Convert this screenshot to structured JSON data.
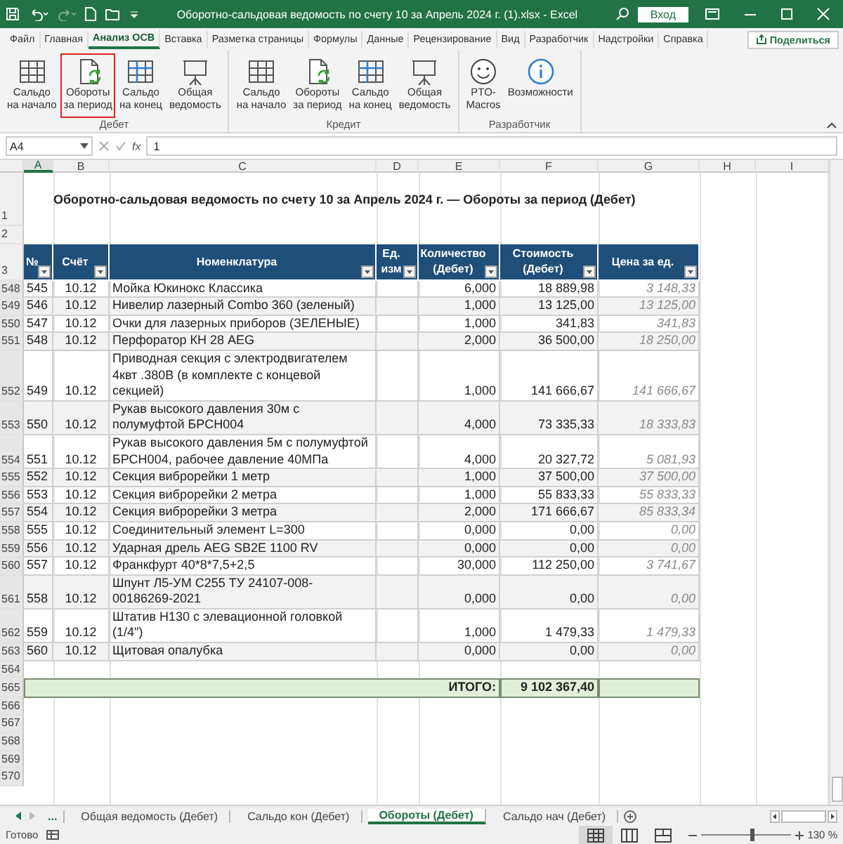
{
  "window": {
    "title": "Оборотно-сальдовая ведомость по счету 10 за Апрель 2024 г. (1).xlsx  -  Excel",
    "sign_in": "Вход",
    "redo_disabled": true
  },
  "ribbon_tabs": [
    {
      "label": "Файл",
      "selected": false
    },
    {
      "label": "Главная",
      "selected": false
    },
    {
      "label": "Анализ ОСВ",
      "selected": true
    },
    {
      "label": "Вставка",
      "selected": false
    },
    {
      "label": "Разметка страницы",
      "selected": false
    },
    {
      "label": "Формулы",
      "selected": false
    },
    {
      "label": "Данные",
      "selected": false
    },
    {
      "label": "Рецензирование",
      "selected": false
    },
    {
      "label": "Вид",
      "selected": false
    },
    {
      "label": "Разработчик",
      "selected": false
    },
    {
      "label": "Надстройки",
      "selected": false
    },
    {
      "label": "Справка",
      "selected": false
    }
  ],
  "share_button": "Поделиться",
  "ribbon_groups": [
    {
      "label": "Дебет",
      "buttons": [
        {
          "label": "Сальдо\nна начало",
          "highlighted": false
        },
        {
          "label": "Обороты\nза период",
          "highlighted": true
        },
        {
          "label": "Сальдо\nна конец",
          "highlighted": false
        },
        {
          "label": "Общая\nведомость",
          "highlighted": false
        }
      ]
    },
    {
      "label": "Кредит",
      "buttons": [
        {
          "label": "Сальдо\nна начало",
          "highlighted": false
        },
        {
          "label": "Обороты\nза период",
          "highlighted": false
        },
        {
          "label": "Сальдо\nна конец",
          "highlighted": false
        },
        {
          "label": "Общая\nведомость",
          "highlighted": false
        }
      ]
    },
    {
      "label": "Разработчик",
      "buttons": [
        {
          "label": "PTO-\nMacros",
          "highlighted": false
        },
        {
          "label": "Возможности",
          "highlighted": false
        }
      ]
    }
  ],
  "formula_bar": {
    "name_box": "A4",
    "function_label": "fx",
    "value": "1"
  },
  "columns": [
    {
      "letter": "A",
      "selected": true
    },
    {
      "letter": "B",
      "selected": false
    },
    {
      "letter": "C",
      "selected": false
    },
    {
      "letter": "D",
      "selected": false
    },
    {
      "letter": "E",
      "selected": false
    },
    {
      "letter": "F",
      "selected": false
    },
    {
      "letter": "G",
      "selected": false
    },
    {
      "letter": "H",
      "selected": false
    },
    {
      "letter": "I",
      "selected": false
    }
  ],
  "title_row": {
    "row_number": "1",
    "text": "Оборотно-сальдовая ведомость по счету 10 за Апрель 2024 г. — Обороты за период (Дебет)"
  },
  "spacer_row": {
    "row_number": "2"
  },
  "header_row": {
    "row_number": "3",
    "labels": [
      "№",
      "Счёт",
      "Номенклатура",
      "Ед. изм",
      "Количество\n(Дебет)",
      "Стоимость\n(Дебет)",
      "Цена за ед."
    ]
  },
  "rows": [
    {
      "kind": "data",
      "row_number": "548",
      "num": "545",
      "account": "10.12",
      "name": "Мойка Юкинокс Классика",
      "qty": "6,000",
      "cost": "18 889,98",
      "price": "3 148,33"
    },
    {
      "kind": "data",
      "row_number": "549",
      "num": "546",
      "account": "10.12",
      "name": "Нивелир лазерный Combo 360 (зеленый)",
      "qty": "1,000",
      "cost": "13 125,00",
      "price": "13 125,00"
    },
    {
      "kind": "data",
      "row_number": "550",
      "num": "547",
      "account": "10.12",
      "name": "Очки для лазерных приборов (ЗЕЛЕНЫЕ)",
      "qty": "1,000",
      "cost": "341,83",
      "price": "341,83"
    },
    {
      "kind": "data",
      "row_number": "551",
      "num": "548",
      "account": "10.12",
      "name": "Перфоратор КН 28 AEG",
      "qty": "2,000",
      "cost": "36 500,00",
      "price": "18 250,00"
    },
    {
      "kind": "data",
      "row_number": "552",
      "num": "549",
      "account": "10.12",
      "name": "Приводная секция с электродвигателем 4квт .380В (в комплекте с концевой секцией)",
      "qty": "1,000",
      "cost": "141 666,67",
      "price": "141 666,67"
    },
    {
      "kind": "data",
      "row_number": "553",
      "num": "550",
      "account": "10.12",
      "name": "Рукав высокого давления 30м с полумуфтой БРСН004",
      "qty": "4,000",
      "cost": "73 335,33",
      "price": "18 333,83"
    },
    {
      "kind": "data",
      "row_number": "554",
      "num": "551",
      "account": "10.12",
      "name": "Рукав высокого давления 5м с полумуфтой БРСН004, рабочее давление 40МПа",
      "qty": "4,000",
      "cost": "20 327,72",
      "price": "5 081,93"
    },
    {
      "kind": "data",
      "row_number": "555",
      "num": "552",
      "account": "10.12",
      "name": "Секция виброрейки 1 метр",
      "qty": "1,000",
      "cost": "37 500,00",
      "price": "37 500,00"
    },
    {
      "kind": "data",
      "row_number": "556",
      "num": "553",
      "account": "10.12",
      "name": "Секция виброрейки 2 метра",
      "qty": "1,000",
      "cost": "55 833,33",
      "price": "55 833,33"
    },
    {
      "kind": "data",
      "row_number": "557",
      "num": "554",
      "account": "10.12",
      "name": "Секция виброрейки 3 метра",
      "qty": "2,000",
      "cost": "171 666,67",
      "price": "85 833,34"
    },
    {
      "kind": "data",
      "row_number": "558",
      "num": "555",
      "account": "10.12",
      "name": "Соединительный элемент L=300",
      "qty": "0,000",
      "cost": "0,00",
      "price": "0,00"
    },
    {
      "kind": "data",
      "row_number": "559",
      "num": "556",
      "account": "10.12",
      "name": "Ударная дрель AEG SB2E  1100 RV",
      "qty": "0,000",
      "cost": "0,00",
      "price": "0,00"
    },
    {
      "kind": "data",
      "row_number": "560",
      "num": "557",
      "account": "10.12",
      "name": "Франкфурт 40*8*7,5+2,5",
      "qty": "30,000",
      "cost": "112 250,00",
      "price": "3 741,67"
    },
    {
      "kind": "data",
      "row_number": "561",
      "num": "558",
      "account": "10.12",
      "name": "Шпунт Л5-УМ С255 ТУ 24107-008-00186269-2021",
      "qty": "0,000",
      "cost": "0,00",
      "price": "0,00"
    },
    {
      "kind": "data",
      "row_number": "562",
      "num": "559",
      "account": "10.12",
      "name": "Штатив H130 с элевационной головкой (1/4\")",
      "qty": "1,000",
      "cost": "1 479,33",
      "price": "1 479,33"
    },
    {
      "kind": "data",
      "row_number": "563",
      "num": "560",
      "account": "10.12",
      "name": "Щитовая опалубка",
      "qty": "0,000",
      "cost": "0,00",
      "price": "0,00"
    },
    {
      "kind": "blank",
      "row_number": "564"
    },
    {
      "kind": "total",
      "row_number": "565",
      "label": "ИТОГО:",
      "value": "9 102 367,40"
    },
    {
      "kind": "blank",
      "row_number": "566"
    },
    {
      "kind": "blank",
      "row_number": "567"
    },
    {
      "kind": "blank",
      "row_number": "568"
    },
    {
      "kind": "blank",
      "row_number": "569"
    },
    {
      "kind": "blank",
      "row_number": "570"
    }
  ],
  "sheet_tabs": {
    "more": "...",
    "tabs": [
      {
        "label": "Общая ведомость (Дебет)",
        "selected": false
      },
      {
        "label": "Сальдо кон (Дебет)",
        "selected": false
      },
      {
        "label": "Обороты (Дебет)",
        "selected": true
      },
      {
        "label": "Сальдо нач (Дебет)",
        "selected": false
      }
    ]
  },
  "status_bar": {
    "status": "Готово",
    "views": [
      {
        "selected": true
      },
      {
        "selected": false
      },
      {
        "selected": false
      }
    ],
    "zoom": {
      "level": 0.55,
      "label": "130 %"
    }
  }
}
